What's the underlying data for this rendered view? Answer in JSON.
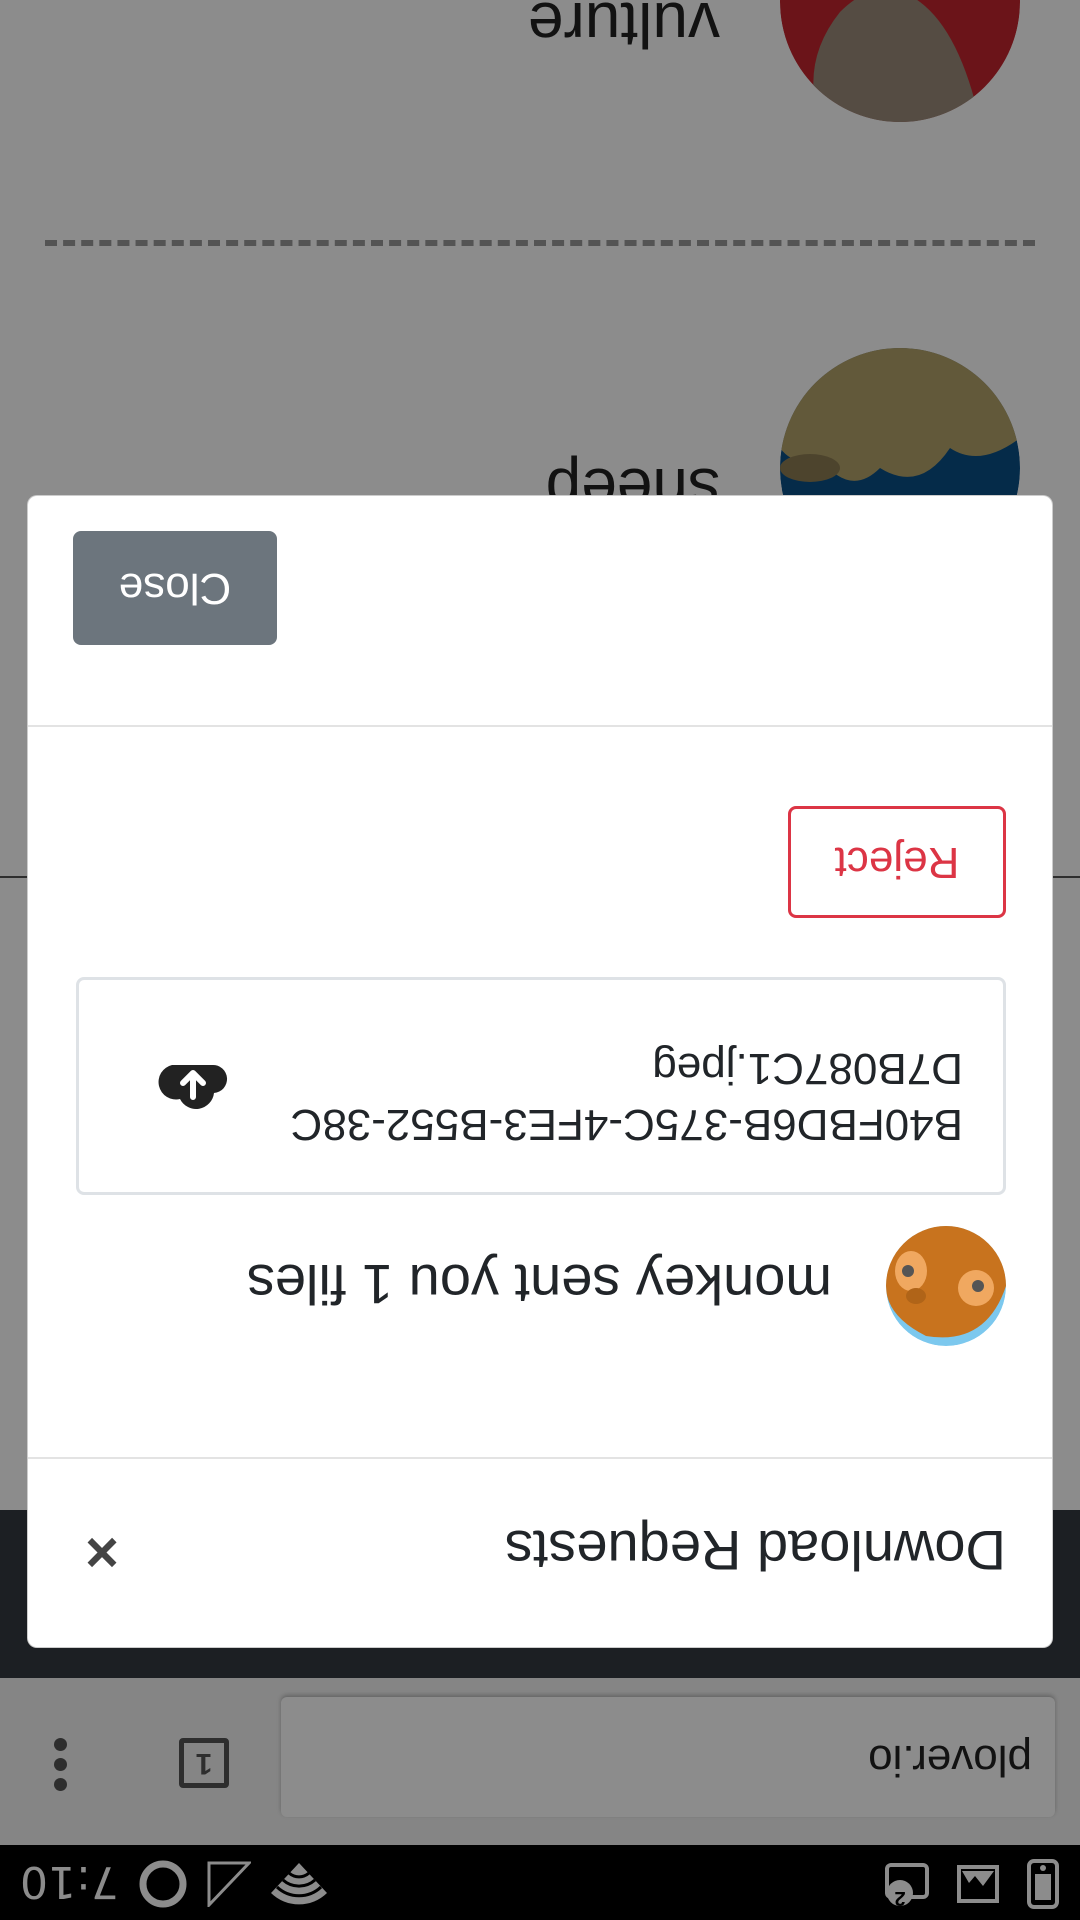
{
  "status_bar": {
    "time": "7:10",
    "notification_count": "2"
  },
  "browser": {
    "url": "plover.io",
    "tab_count": "1"
  },
  "page": {
    "animals": [
      {
        "name": "sheep"
      },
      {
        "name": "vulture"
      }
    ]
  },
  "modal": {
    "title": "Download Requests",
    "close_symbol": "×",
    "request_text": "monkey sent you 1 files",
    "file_name": "B40FBD6B-375C-4FE3-B552-38CD7B087C1.jpeg",
    "reject_label": "Reject",
    "close_label": "Close"
  },
  "colors": {
    "danger": "#dc3545",
    "secondary": "#6c757d",
    "navbar": "#343a40",
    "monkey_bg": "#7cc8ee",
    "monkey_fur": "#c8731e",
    "sheep_bg": "#0a4f86",
    "vulture_bg": "#c4262e"
  }
}
